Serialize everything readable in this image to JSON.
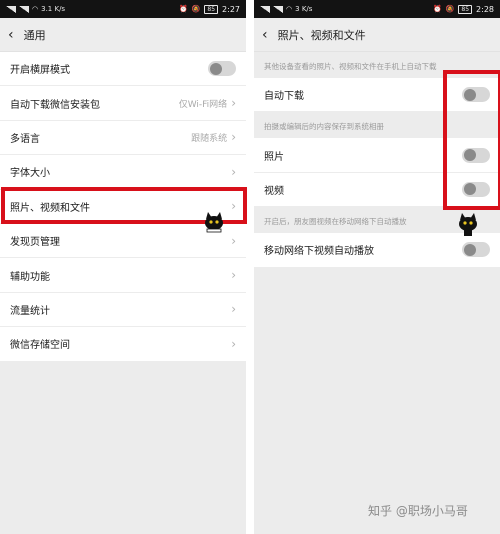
{
  "left": {
    "status": {
      "signal": "᷉ᶫ⁵⁶",
      "speed_value": "3.1",
      "speed_unit": "K/s",
      "battery": "85",
      "time": "2:27"
    },
    "title": "通用",
    "items": [
      {
        "label": "开启横屏模式",
        "value": "",
        "control": "toggle-off"
      },
      {
        "label": "自动下载微信安装包",
        "value": "仅Wi-Fi网络",
        "control": "chevron"
      },
      {
        "label": "多语言",
        "value": "跟随系统",
        "control": "chevron"
      },
      {
        "label": "字体大小",
        "value": "",
        "control": "chevron"
      },
      {
        "label": "照片、视频和文件",
        "value": "",
        "control": "chevron"
      },
      {
        "label": "发现页管理",
        "value": "",
        "control": "chevron"
      },
      {
        "label": "辅助功能",
        "value": "",
        "control": "chevron"
      },
      {
        "label": "流量统计",
        "value": "",
        "control": "chevron"
      },
      {
        "label": "微信存储空间",
        "value": "",
        "control": "chevron"
      }
    ]
  },
  "right": {
    "status": {
      "speed_value": "3",
      "speed_unit": "K/s",
      "battery": "85",
      "time": "2:28"
    },
    "title": "照片、视频和文件",
    "sections": [
      {
        "hint": "其他设备查看的照片、视频和文件在手机上自动下载",
        "items": [
          {
            "label": "自动下载",
            "control": "toggle-off"
          }
        ]
      },
      {
        "hint": "拍摄或编辑后的内容保存到系统相册",
        "items": [
          {
            "label": "照片",
            "control": "toggle-off"
          },
          {
            "label": "视频",
            "control": "toggle-off"
          }
        ]
      },
      {
        "hint": "开启后，朋友圈视频在移动网络下自动播放",
        "items": [
          {
            "label": "移动网络下视频自动播放",
            "control": "toggle-off"
          }
        ]
      }
    ]
  },
  "watermark": "知乎 @职场小马哥",
  "colors": {
    "highlight": "#d8101a",
    "background": "#ececec"
  }
}
